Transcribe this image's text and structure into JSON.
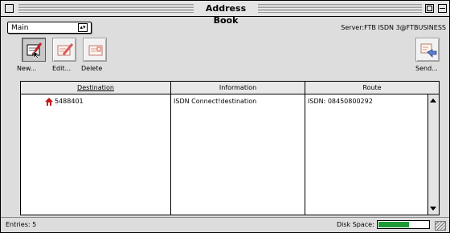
{
  "window": {
    "title": "Address Book"
  },
  "header": {
    "popup_value": "Main",
    "popup_arrows": "▴▾",
    "server": "Server:FTB ISDN 3@FTBUSINESS"
  },
  "toolbar": {
    "new_label": "New...",
    "edit_label": "Edit...",
    "delete_label": "Delete",
    "send_label": "Send..."
  },
  "table": {
    "columns": [
      "Destination",
      "Information",
      "Route"
    ],
    "sorted_column": "Destination",
    "rows": [
      {
        "destination": "5488401",
        "information": "ISDN Connect!destination",
        "route": "ISDN: 08450800292"
      }
    ]
  },
  "status": {
    "entries": "Entries: 5",
    "disk_label": "Disk Space:",
    "disk_fill_fraction": 0.62,
    "disk_color": "#1d9a35"
  }
}
